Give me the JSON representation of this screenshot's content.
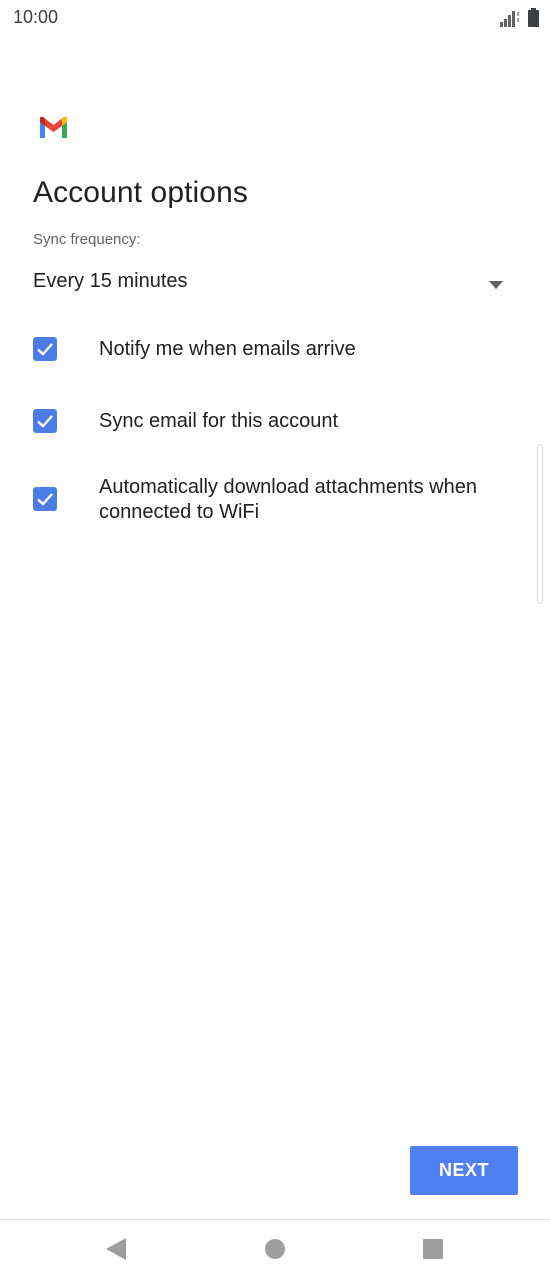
{
  "status_bar": {
    "time": "10:00",
    "icons": [
      "signal-icon",
      "battery-icon"
    ]
  },
  "app": {
    "logo": "gmail-logo",
    "colors": {
      "accent": "#4f7ff0",
      "checkbox": "#4a7ee6"
    }
  },
  "page": {
    "title": "Account options",
    "sync_label": "Sync frequency:",
    "sync_value": "Every 15 minutes"
  },
  "options": [
    {
      "label": "Notify me when emails arrive",
      "checked": true
    },
    {
      "label": "Sync email for this account",
      "checked": true
    },
    {
      "label": "Automatically download attachments when connected to WiFi",
      "checked": true
    }
  ],
  "actions": {
    "next_label": "NEXT"
  },
  "nav_bar": {
    "icons": [
      "back-icon",
      "home-icon",
      "recents-icon"
    ]
  }
}
